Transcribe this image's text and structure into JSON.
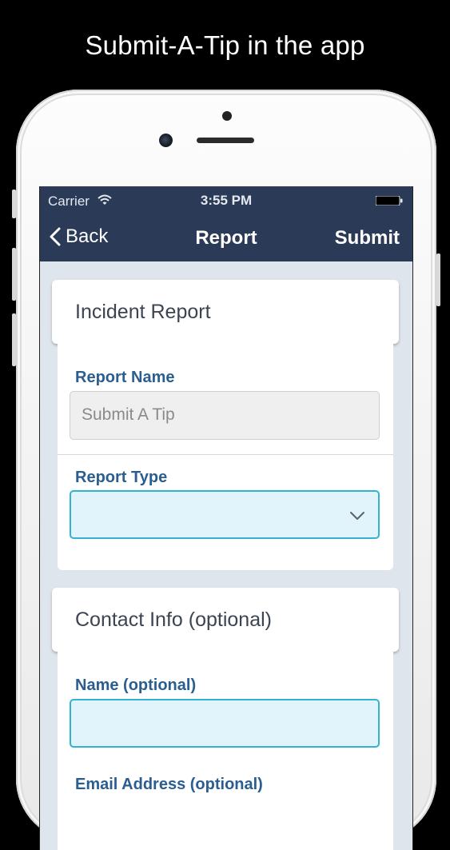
{
  "headline": "Submit-A-Tip in the app",
  "status_bar": {
    "carrier": "Carrier",
    "time": "3:55 PM"
  },
  "nav": {
    "back_label": "Back",
    "title": "Report",
    "submit_label": "Submit"
  },
  "incident_section": {
    "title": "Incident Report",
    "report_name_label": "Report Name",
    "report_name_value": "Submit A Tip",
    "report_type_label": "Report Type",
    "report_type_value": ""
  },
  "contact_section": {
    "title": "Contact Info (optional)",
    "name_label": "Name (optional)",
    "name_value": "",
    "email_label": "Email Address (optional)"
  },
  "colors": {
    "nav_bar": "#2b3b57",
    "label": "#2a5e90",
    "field_active_border": "#33b3cf",
    "field_active_bg": "#e1f3fb"
  }
}
